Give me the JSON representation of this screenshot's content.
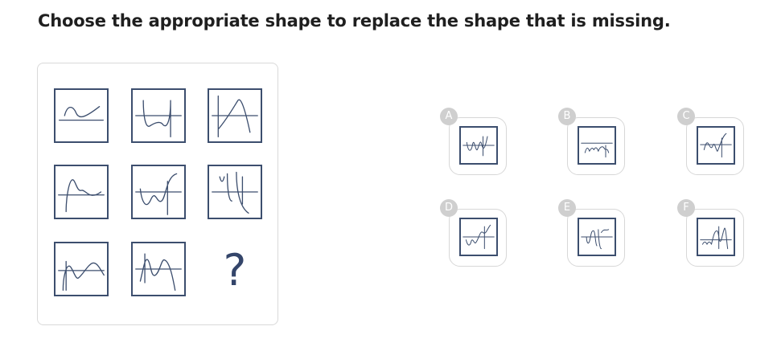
{
  "question": "Choose the appropriate shape to replace the shape that is missing.",
  "matrix": {
    "missing_symbol": "?"
  },
  "options": [
    {
      "label": "A"
    },
    {
      "label": "B"
    },
    {
      "label": "C"
    },
    {
      "label": "D"
    },
    {
      "label": "E"
    },
    {
      "label": "F"
    }
  ],
  "colors": {
    "tile_border": "#3c4e6e",
    "badge": "#cfcfcf",
    "card_border": "#d7d7d7"
  }
}
